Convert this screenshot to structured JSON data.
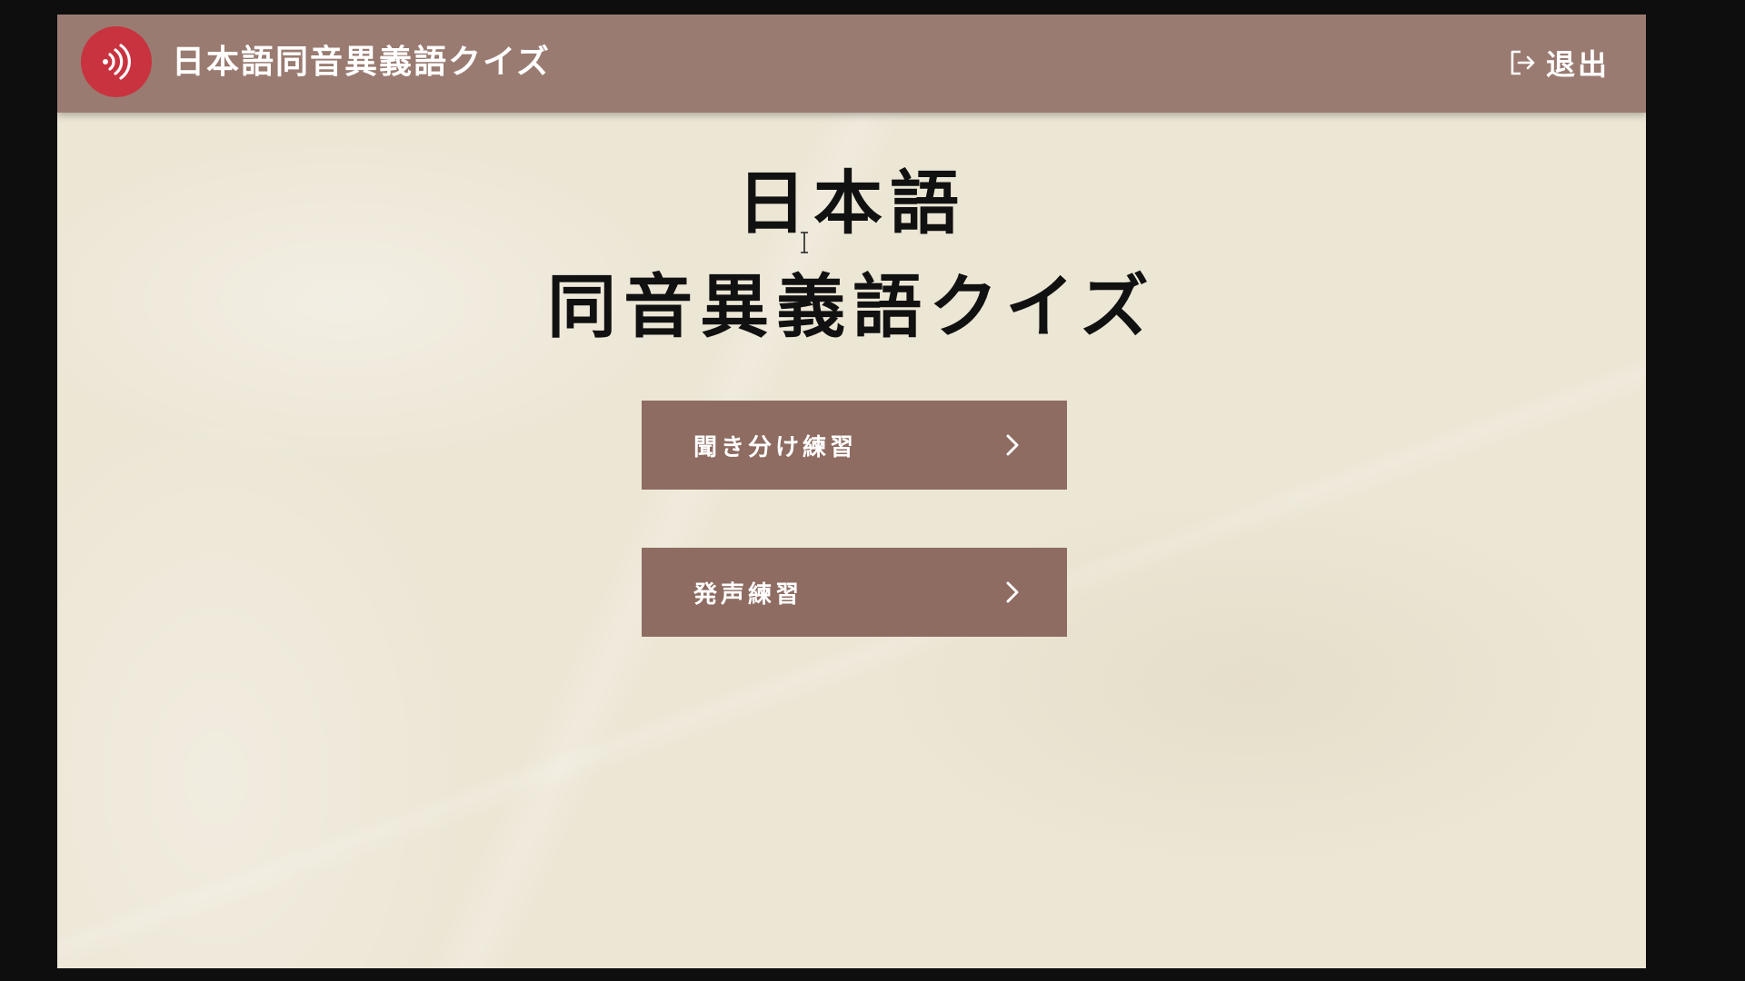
{
  "header": {
    "title": "日本語同音異義語クイズ",
    "logo_icon": "sound-wave-icon",
    "exit_label": "退出",
    "exit_icon": "logout-icon"
  },
  "main": {
    "title_line1": "日本語",
    "title_line2": "同音異義語クイズ",
    "buttons": [
      {
        "label": "聞き分け練習",
        "icon": "chevron-right-icon"
      },
      {
        "label": "発声練習",
        "icon": "chevron-right-icon"
      }
    ]
  },
  "colors": {
    "header_bg": "#9a7b71",
    "logo_bg": "#c8333f",
    "button_bg": "#8e6c62",
    "paper_bg": "#ece6d5",
    "title_text": "#111111"
  }
}
